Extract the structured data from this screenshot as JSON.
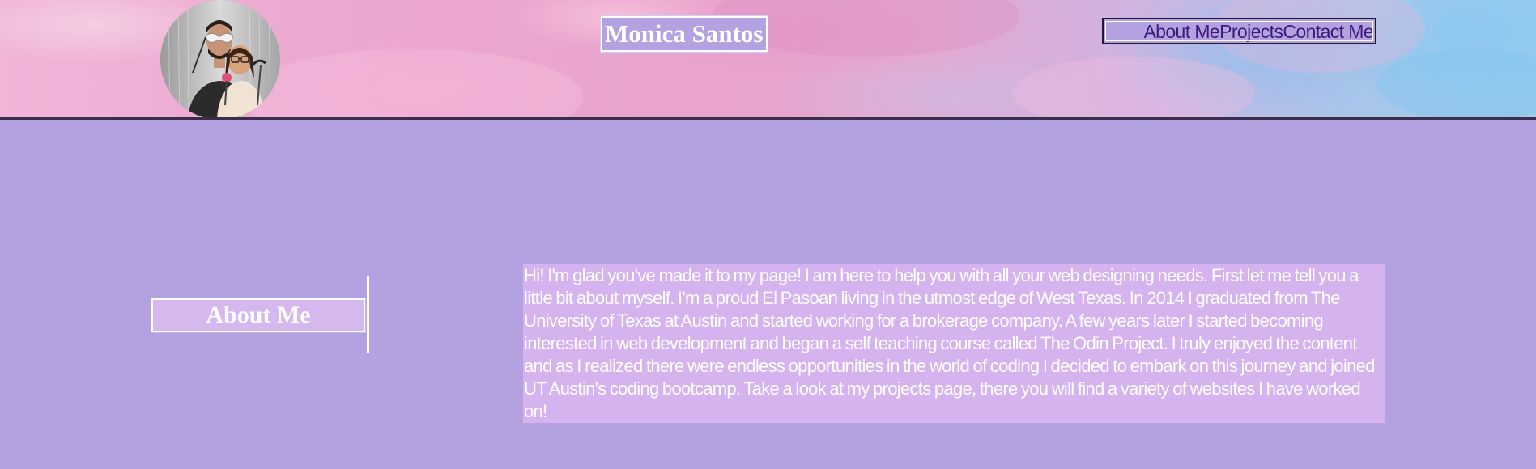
{
  "header": {
    "title": "Monica Santos",
    "avatar_icon": "profile-photo",
    "nav": [
      {
        "label": "About Me"
      },
      {
        "label": "Projects"
      },
      {
        "label": "Contact Me"
      }
    ]
  },
  "about": {
    "heading": "About Me",
    "body": "Hi! I'm glad you've made it to my page! I am here to help you with all your web designing needs. First let me tell you a little bit about myself. I'm a proud El Pasoan living in the utmost edge of West Texas. In 2014 I graduated from The University of Texas at Austin and started working for a brokerage company. A few years later I started becoming interested in web development and began a self teaching course called The Odin Project. I truly enjoyed the content and as I realized there were endless opportunities in the world of coding I decided to embark on this journey and joined UT Austin's coding bootcamp. Take a look at my projects page, there you will find a variety of websites I have worked on!"
  },
  "colors": {
    "page_background": "#b3a1e0",
    "heading_background": "#d5b8ee",
    "bio_background": "#d4b3ee",
    "nav_link": "#3d1a7a",
    "text": "#ffffff"
  }
}
